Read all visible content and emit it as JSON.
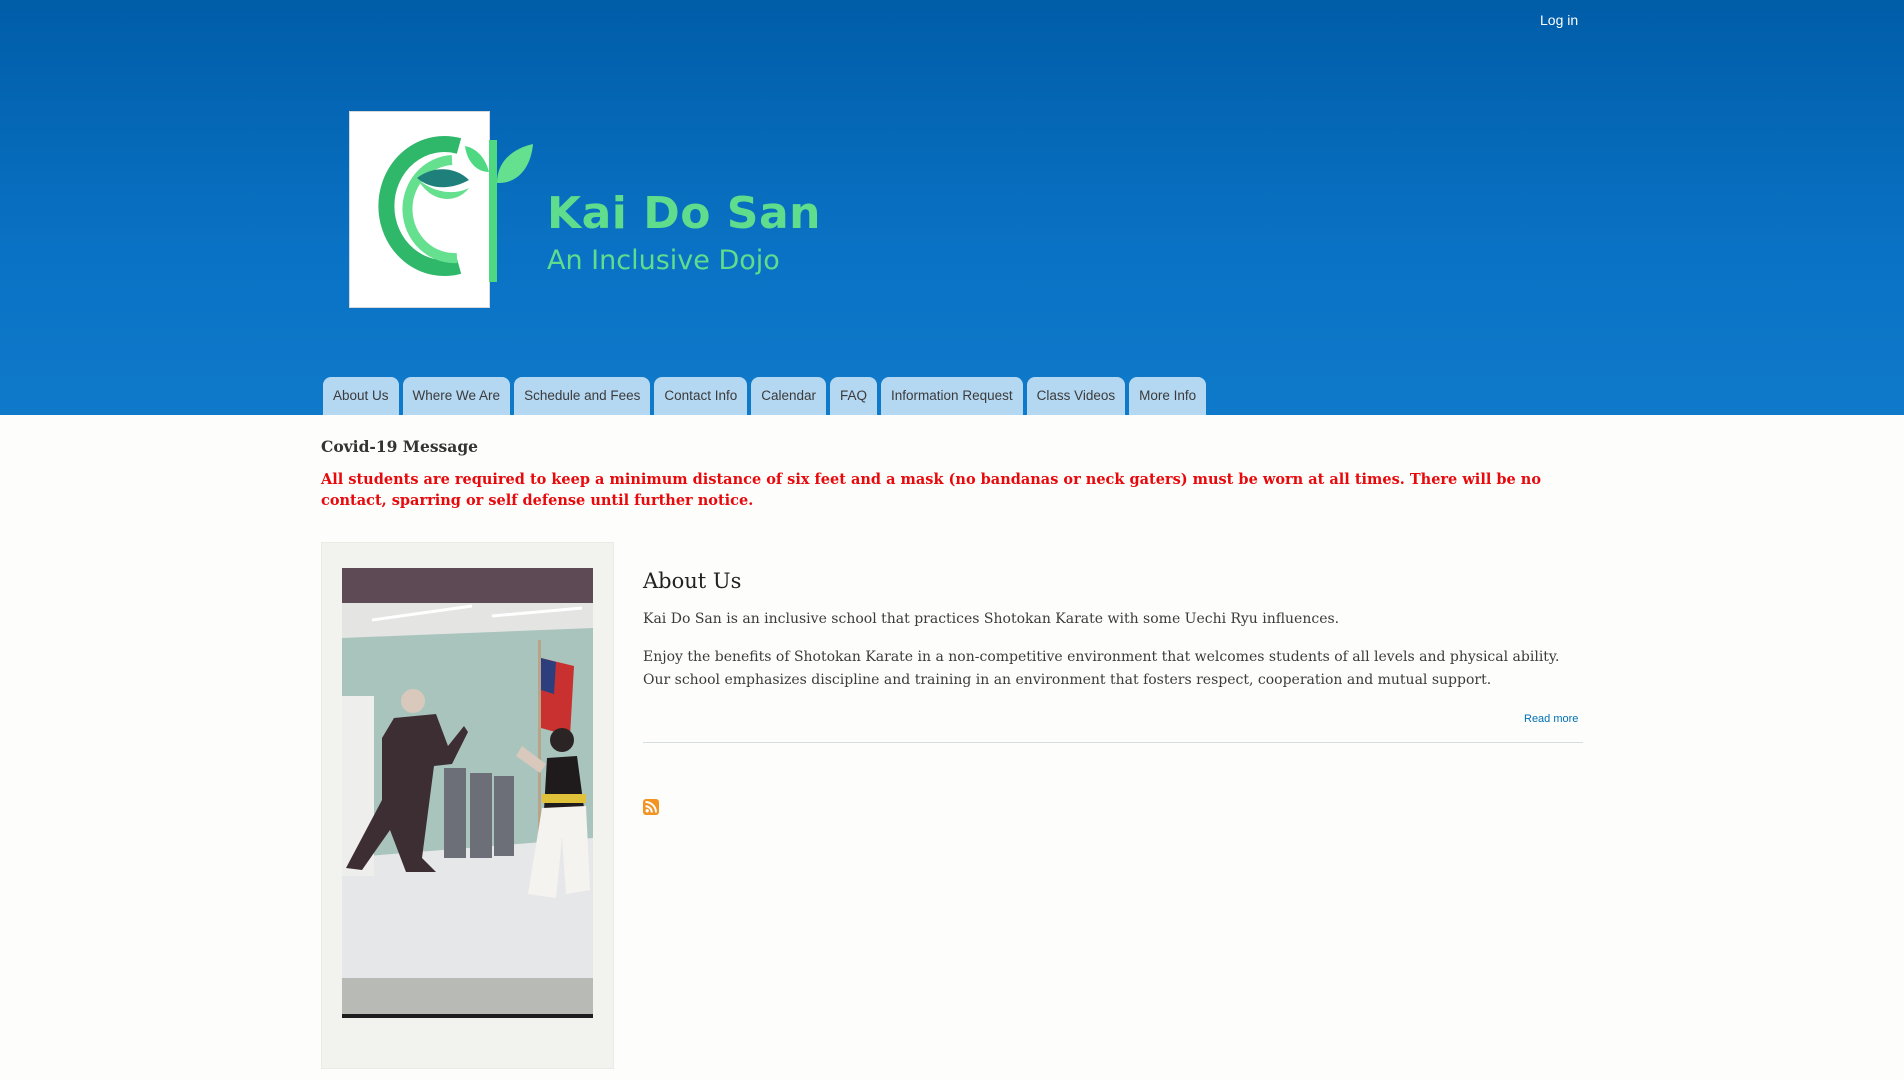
{
  "header": {
    "login_label": "Log in",
    "site_name": "Kai Do San",
    "site_slogan": "An Inclusive Dojo",
    "logo_icon": "sprout-logo-icon",
    "colors": {
      "header_top": "#005da8",
      "header_bottom": "#0f79ca",
      "brand_green": "#5fdd8c",
      "tab_bg": "#b4d7f2"
    }
  },
  "main_menu": {
    "items": [
      {
        "label": "About Us"
      },
      {
        "label": "Where We Are"
      },
      {
        "label": "Schedule and Fees"
      },
      {
        "label": "Contact Info"
      },
      {
        "label": "Calendar"
      },
      {
        "label": "FAQ"
      },
      {
        "label": "Information Request"
      },
      {
        "label": "Class Videos"
      },
      {
        "label": "More Info"
      }
    ]
  },
  "notice": {
    "title": "Covid-19 Message",
    "message": "All students are required to keep a minimum distance of six feet and a mask (no bandanas or neck gaters) must be worn at all times. There will be no contact, sparring or self defense until further notice.",
    "color": "#e8090d"
  },
  "sidebar": {
    "photo_icon": "karate-sparring-photo"
  },
  "content": {
    "title": "About Us",
    "paragraph_1": " Kai Do San is an inclusive school that practices Shotokan Karate with some Uechi Ryu influences.",
    "paragraph_2": " Enjoy the benefits of Shotokan Karate in a non-competitive environment that welcomes students of all levels and physical ability. Our school emphasizes discipline and training in an environment that fosters respect, cooperation and mutual support.",
    "read_more": "Read more",
    "feed_icon": "rss-feed-icon",
    "link_color": "#0071b3"
  }
}
